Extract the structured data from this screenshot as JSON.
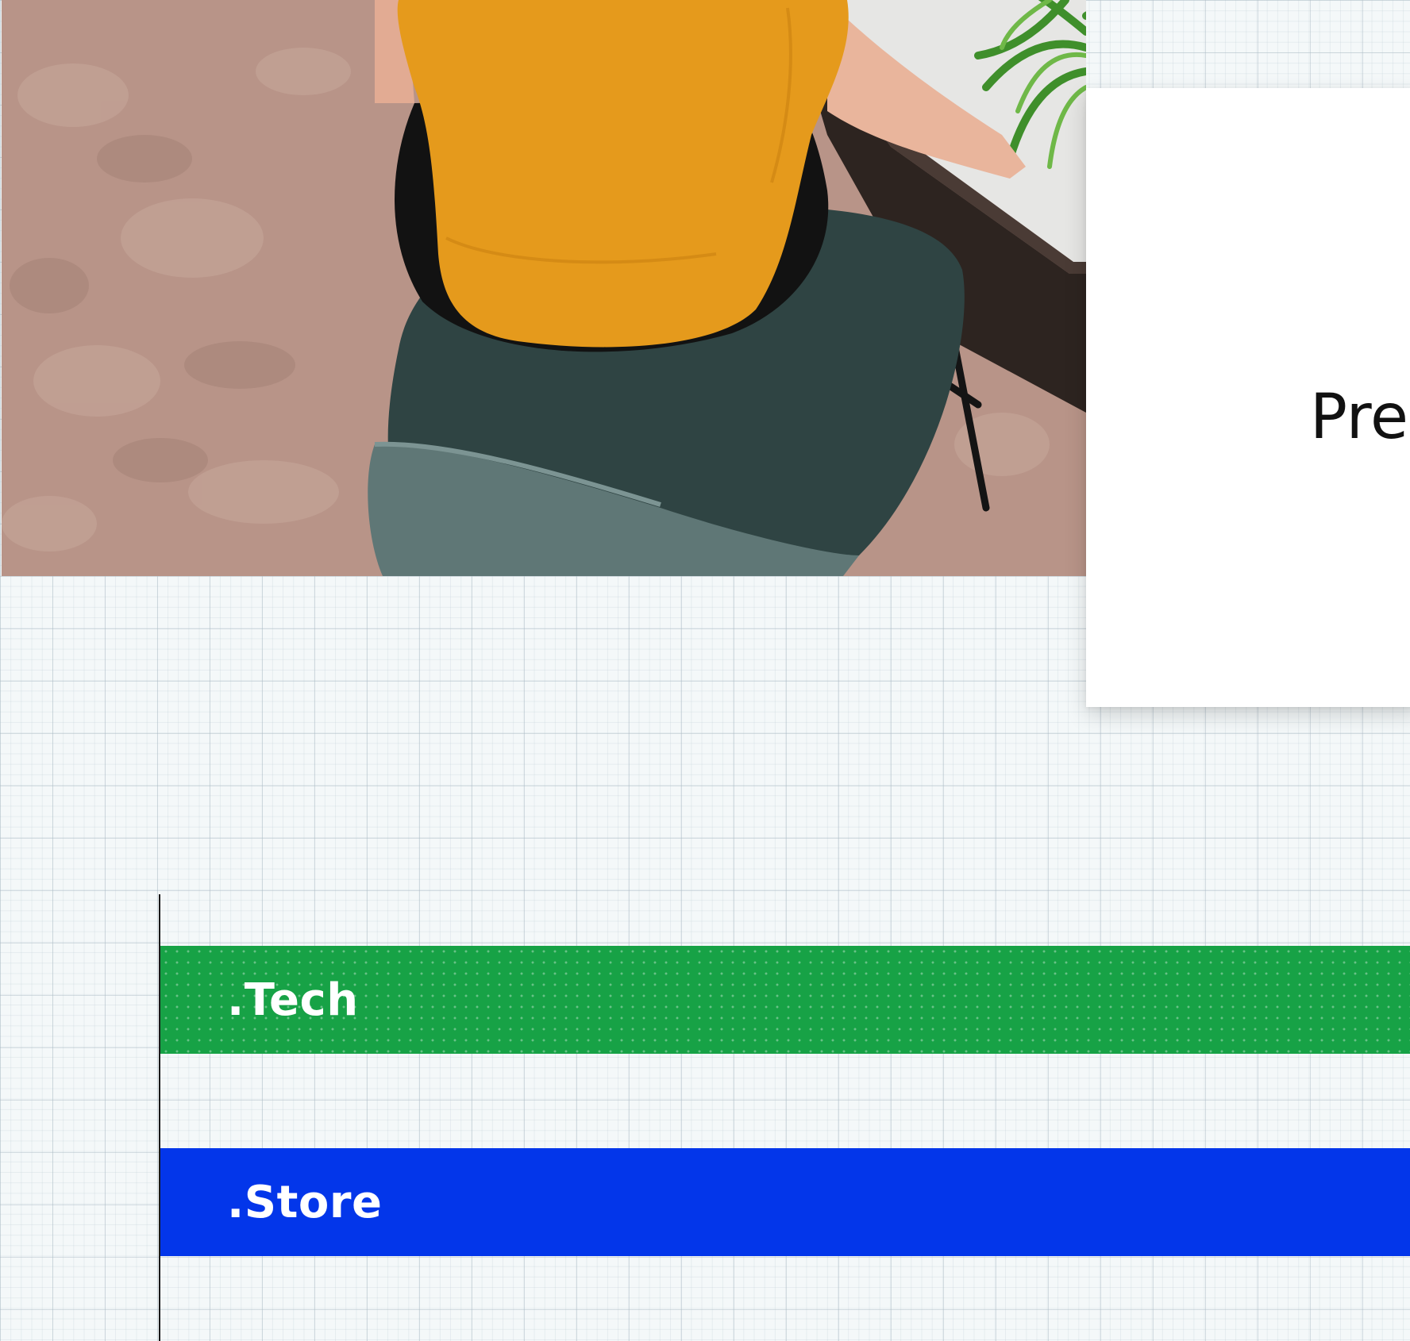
{
  "hero": {
    "image_icon": "photo-person-at-desk-icon"
  },
  "promo_card": {
    "text": "Pre"
  },
  "extensions": [
    {
      "label": ".Tech",
      "color": "#17a246"
    },
    {
      "label": ".Store",
      "color": "#0336ea"
    }
  ],
  "colors": {
    "grid_background": "#f4f8f9",
    "card": "#ffffff",
    "tech_bar": "#17a246",
    "store_bar": "#0336ea"
  }
}
